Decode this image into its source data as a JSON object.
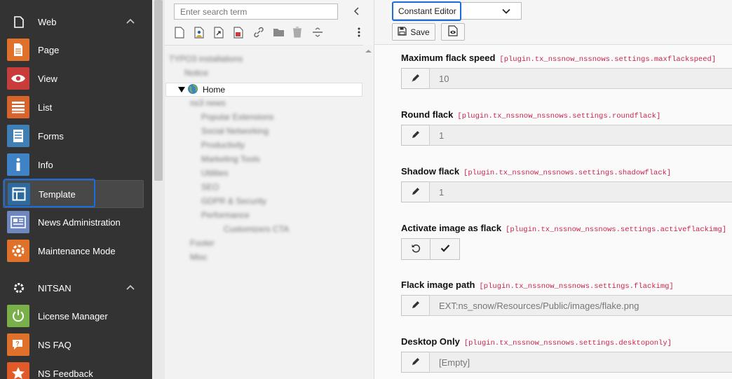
{
  "sidebar": {
    "groups": [
      {
        "label": "Web",
        "icon": "page-icon"
      },
      {
        "label": "NITSAN",
        "icon": "gear-icon"
      }
    ],
    "modules": [
      {
        "label": "Page",
        "icon": "page-module-icon",
        "color": "#e0712a"
      },
      {
        "label": "View",
        "icon": "eye-icon",
        "color": "#c83c3c"
      },
      {
        "label": "List",
        "icon": "list-icon",
        "color": "#d9642b"
      },
      {
        "label": "Forms",
        "icon": "forms-icon",
        "color": "#3f7fb5"
      },
      {
        "label": "Info",
        "icon": "info-icon",
        "color": "#3f82c6"
      },
      {
        "label": "Template",
        "icon": "template-icon",
        "color": "#2d6aa0"
      },
      {
        "label": "News Administration",
        "icon": "news-icon",
        "color": "#6f87c0"
      },
      {
        "label": "Maintenance Mode",
        "icon": "maintenance-icon",
        "color": "#e0712a"
      },
      {
        "label": "License Manager",
        "icon": "power-icon",
        "color": "#79b04a"
      },
      {
        "label": "NS FAQ",
        "icon": "faq-icon",
        "color": "#e0712a"
      },
      {
        "label": "NS Feedback",
        "icon": "star-icon",
        "color": "#e05a2a"
      }
    ]
  },
  "tree": {
    "search_placeholder": "Enter search term",
    "home_label": "Home",
    "blurred_items": [
      "TYPO3 installations",
      "Notice",
      "Home",
      "ns3 news",
      "Popular Extensions",
      "Social Networking",
      "Productivity",
      "Marketing Tools",
      "Utilities",
      "SEO",
      "GDPR & Security",
      "Performance",
      "Customizers CTA",
      "Footer",
      "Misc"
    ]
  },
  "main": {
    "function_select": "Constant Editor",
    "save_label": "Save",
    "settings": [
      {
        "title": "Maximum flack speed",
        "key": "[plugin.tx_nssnow_nssnows.settings.maxflackspeed]",
        "value": "10"
      },
      {
        "title": "Round flack",
        "key": "[plugin.tx_nssnow_nssnows.settings.roundflack]",
        "value": "1"
      },
      {
        "title": "Shadow flack",
        "key": "[plugin.tx_nssnow_nssnows.settings.shadowflack]",
        "value": "1"
      },
      {
        "title": "Activate image as flack",
        "key": "[plugin.tx_nssnow_nssnows.settings.activeflackimg]",
        "value": ""
      },
      {
        "title": "Flack image path",
        "key": "[plugin.tx_nssnow_nssnows.settings.flackimg]",
        "value": "EXT:ns_snow/Resources/Public/images/flake.png"
      },
      {
        "title": "Desktop Only",
        "key": "[plugin.tx_nssnow_nssnows.settings.desktoponly]",
        "value": "[Empty]"
      }
    ]
  }
}
